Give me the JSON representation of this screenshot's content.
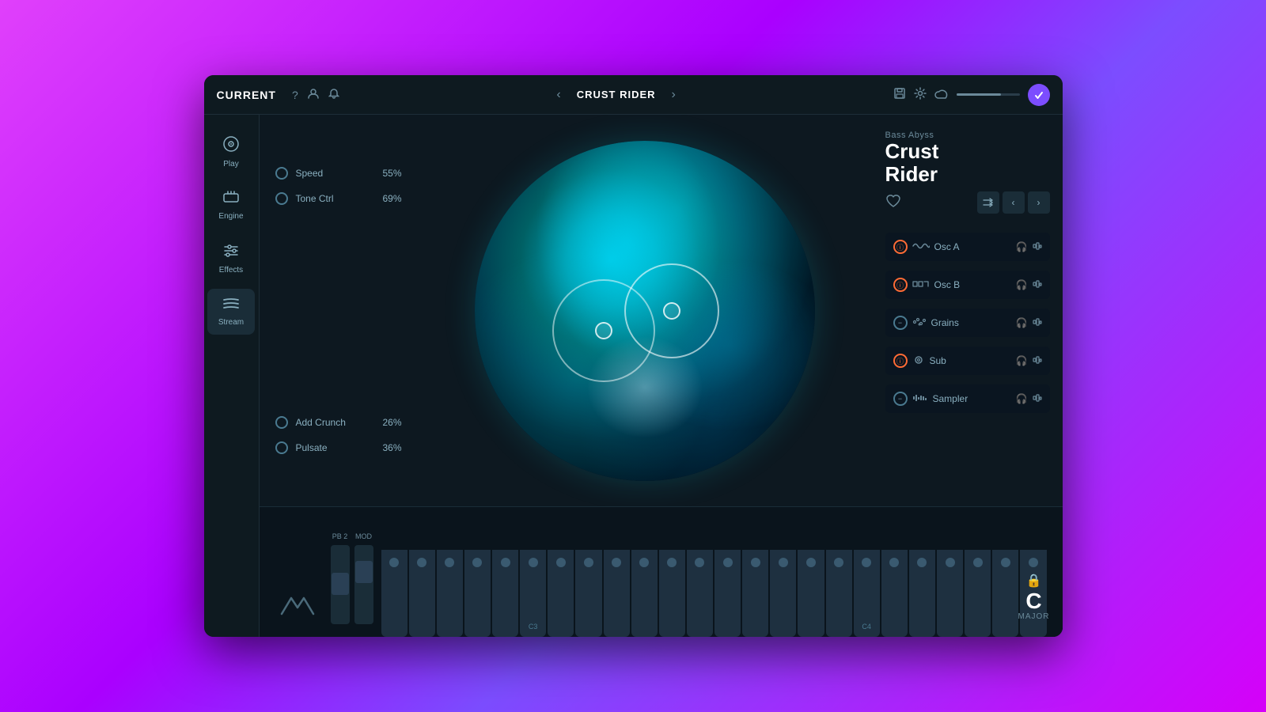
{
  "header": {
    "brand": "CURRENT",
    "title": "CRUST RIDER",
    "icons": {
      "help": "?",
      "user": "👤",
      "bell": "🔔",
      "prev": "‹",
      "next": "›",
      "save": "💾",
      "settings": "⚙",
      "cloud": "☁"
    }
  },
  "sidebar": {
    "items": [
      {
        "id": "play",
        "label": "Play",
        "icon": "⊙"
      },
      {
        "id": "engine",
        "label": "Engine",
        "icon": "⊓"
      },
      {
        "id": "effects",
        "label": "Effects",
        "icon": "⫿"
      },
      {
        "id": "stream",
        "label": "Stream",
        "icon": "≋"
      }
    ]
  },
  "controls": {
    "knobs": [
      {
        "id": "speed",
        "label": "Speed",
        "value": "55%"
      },
      {
        "id": "tone-ctrl",
        "label": "Tone Ctrl",
        "value": "69%"
      },
      {
        "id": "add-crunch",
        "label": "Add Crunch",
        "value": "26%"
      },
      {
        "id": "pulsate",
        "label": "Pulsate",
        "value": "36%"
      }
    ]
  },
  "preset": {
    "category": "Bass Abyss",
    "name_line1": "Crust",
    "name_line2": "Rider"
  },
  "oscillators": [
    {
      "id": "osc-a",
      "label": "Osc A",
      "type": "wave",
      "power": "active",
      "icon": "∿"
    },
    {
      "id": "osc-b",
      "label": "Osc B",
      "type": "square",
      "power": "active",
      "icon": "⊓"
    },
    {
      "id": "grains",
      "label": "Grains",
      "type": "grains",
      "power": "minus",
      "icon": "⁙"
    },
    {
      "id": "sub",
      "label": "Sub",
      "type": "circle",
      "power": "active",
      "icon": "⊙"
    },
    {
      "id": "sampler",
      "label": "Sampler",
      "type": "sampler",
      "power": "minus",
      "icon": "⫿"
    }
  ],
  "keyboard": {
    "pb_label": "PB  2",
    "mod_label": "MOD",
    "c3_label": "C3",
    "c4_label": "C4",
    "note": "C",
    "scale": "MAJOR",
    "lock_icon": "🔒"
  }
}
